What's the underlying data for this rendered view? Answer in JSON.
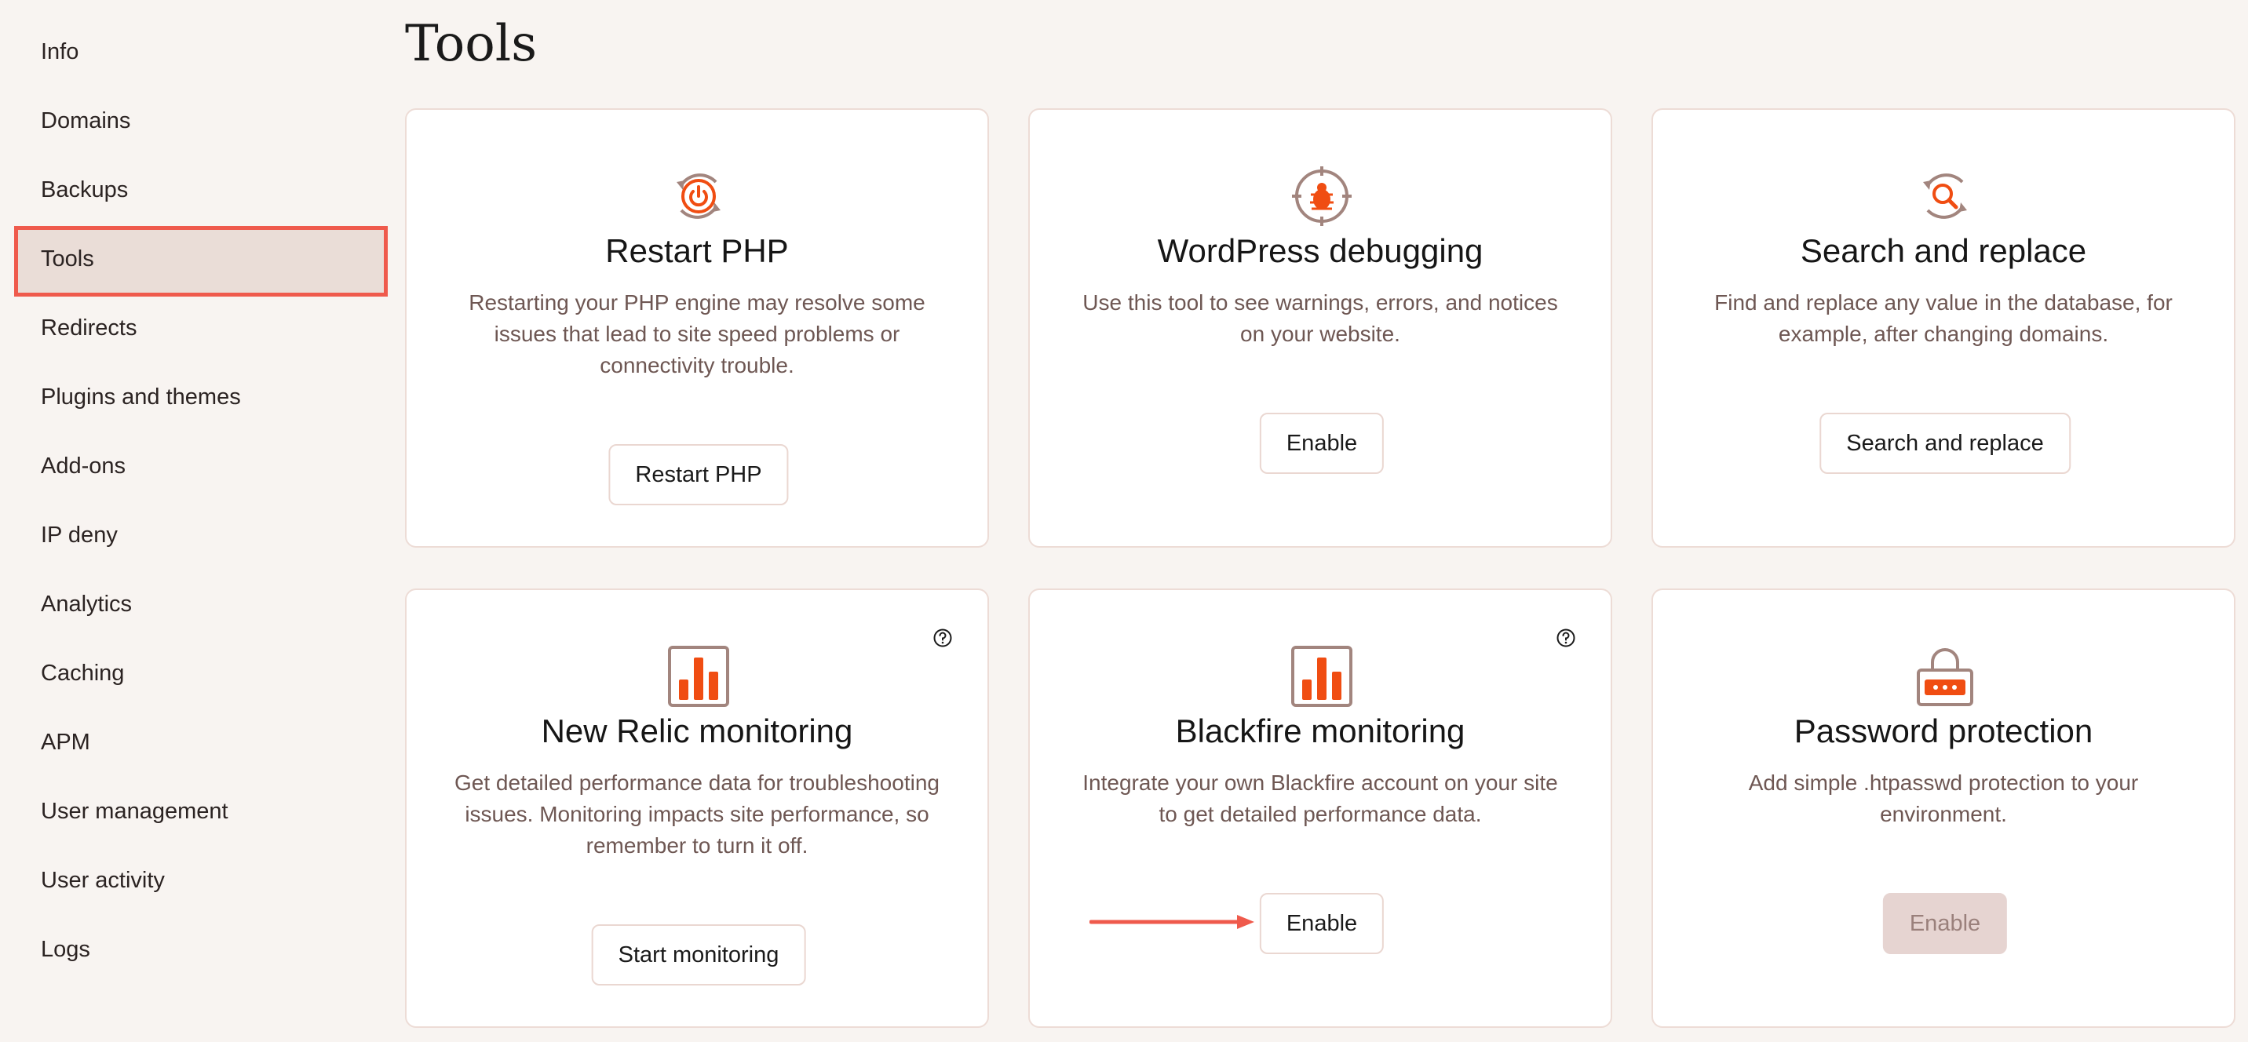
{
  "sidebar": {
    "items": [
      {
        "label": "Info"
      },
      {
        "label": "Domains"
      },
      {
        "label": "Backups"
      },
      {
        "label": "Tools"
      },
      {
        "label": "Redirects"
      },
      {
        "label": "Plugins and themes"
      },
      {
        "label": "Add-ons"
      },
      {
        "label": "IP deny"
      },
      {
        "label": "Analytics"
      },
      {
        "label": "Caching"
      },
      {
        "label": "APM"
      },
      {
        "label": "User management"
      },
      {
        "label": "User activity"
      },
      {
        "label": "Logs"
      }
    ],
    "active": "Tools"
  },
  "page": {
    "title": "Tools"
  },
  "cards": [
    {
      "title": "Restart PHP",
      "desc": "Restarting your PHP engine may resolve some issues that lead to site speed problems or connectivity trouble.",
      "button": "Restart PHP",
      "icon": "power-restart-icon"
    },
    {
      "title": "WordPress debugging",
      "desc": "Use this tool to see warnings, errors, and notices on your website.",
      "button": "Enable",
      "icon": "bug-target-icon"
    },
    {
      "title": "Search and replace",
      "desc": "Find and replace any value in the database, for example, after changing domains.",
      "button": "Search and replace",
      "icon": "search-refresh-icon"
    },
    {
      "title": "New Relic monitoring",
      "desc": "Get detailed performance data for troubleshooting issues. Monitoring impacts site performance, so remember to turn it off.",
      "button": "Start monitoring",
      "icon": "bar-chart-icon",
      "help": "help-icon"
    },
    {
      "title": "Blackfire monitoring",
      "desc": "Integrate your own Blackfire account on your site to get detailed performance data.",
      "button": "Enable",
      "icon": "bar-chart-icon",
      "help": "help-icon"
    },
    {
      "title": "Password protection",
      "desc": "Add simple .htpasswd protection to your environment.",
      "button": "Enable",
      "button_disabled": true,
      "icon": "padlock-icon"
    }
  ],
  "colors": {
    "accent": "#ef5a4c",
    "icon_orange": "#f04d12",
    "icon_brown": "#a2857e",
    "background": "#f8f4f1",
    "active_bg": "#eaddd7"
  }
}
